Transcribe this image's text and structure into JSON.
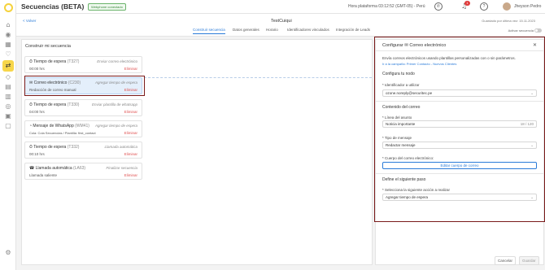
{
  "app": {
    "title": "Secuencias (BETA)",
    "platform_badge": "Webphone conectado"
  },
  "topbar": {
    "platform_time": "Hora plataforma 03:12:52 (GMT-05) - Perú",
    "notif_count": "1",
    "help_label": "?",
    "user_name": "Jheyson Pedro"
  },
  "subheader": {
    "back_label": "< Volver",
    "sequence_name": "TestCuiqui",
    "saved_label": "Guardado por última vez: 15.11.2023",
    "active_label": "Activar secuencia"
  },
  "tabs": [
    "Construir secuencia",
    "Datos generales",
    "Horario",
    "Identificadores vinculados",
    "Integración de Leads"
  ],
  "builder": {
    "title": "Construir mi secuencia",
    "cards": [
      {
        "title": "Tiempo de espera",
        "id": "(T327)",
        "sub": "00:00 hrs",
        "action": "Enviar correo electrónico",
        "delete": "Eliminar"
      },
      {
        "title": "Correo electrónico",
        "id": "(C230)",
        "sub": "Redacción de correo manual",
        "action": "Agregar tiempo de espera",
        "delete": "Eliminar"
      },
      {
        "title": "Tiempo de espera",
        "id": "(T330)",
        "sub": "04:00 hrs",
        "action": "Enviar plantilla de whatsapp",
        "delete": "Eliminar"
      },
      {
        "title": "Mensaje de WhatsApp",
        "id": "(WM41)",
        "sub": "Cola: Cola Secuencias / Plantilla: first_contact",
        "action": "Agregar tiempo de espera",
        "delete": "Eliminar"
      },
      {
        "title": "Tiempo de espera",
        "id": "(T332)",
        "sub": "00:10 hrs",
        "action": "Llamada automática",
        "delete": "Eliminar"
      },
      {
        "title": "Llamada automática",
        "id": "(LA63)",
        "sub": "Llamada saliente",
        "action": "Finalizar secuencia",
        "delete": "Eliminar"
      }
    ]
  },
  "panel": {
    "title": "Configurar ✉ Correo electrónico",
    "close": "✕",
    "desc": "Envía correos electrónicos usando plantillas personalizadas con o sin parámetros.",
    "link": "Ir a la campaña: Primer Contacto - Nuevos Clientes",
    "node_section": "Configura tu nodo",
    "identifier_label": "* Identificador a utilizar",
    "identifier_value": "ozone.noreply@securitec.pe",
    "content_section": "Contenido del correo",
    "subject_label": "* Línea del asunto",
    "subject_value": "Noticia importante",
    "subject_count": "18 / 120",
    "type_label": "* Tipo de mensaje",
    "type_value": "Redactar mensaje",
    "body_label": "* Cuerpo del correo electrónico:",
    "edit_body_button": "Editar cuerpo de correo",
    "next_section": "Define el siguiente paso",
    "next_label": "* Selecciona la siguiente acción a realizar",
    "next_value": "Agregar tiempo de espera"
  },
  "footer": {
    "cancel": "Cancelar",
    "save": "Guardar"
  }
}
